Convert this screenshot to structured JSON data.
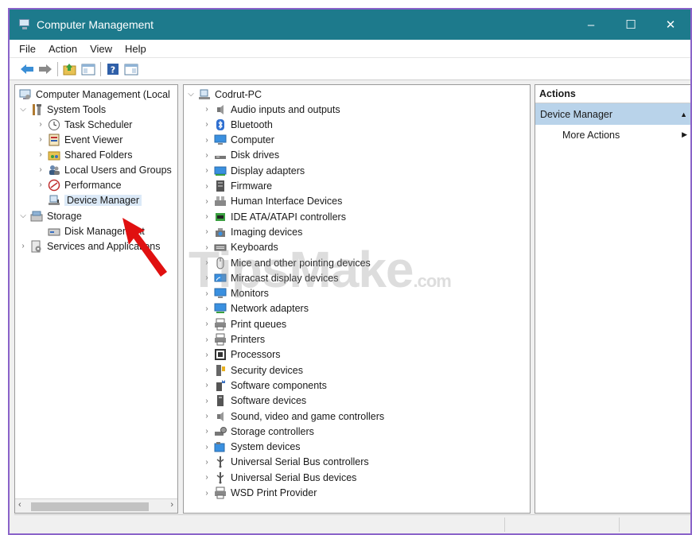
{
  "window": {
    "title": "Computer Management",
    "minimize": "–",
    "maximize": "☐",
    "close": "✕"
  },
  "menu": [
    "File",
    "Action",
    "View",
    "Help"
  ],
  "tree": {
    "root": "Computer Management (Local",
    "system_tools": "System Tools",
    "system_items": [
      "Task Scheduler",
      "Event Viewer",
      "Shared Folders",
      "Local Users and Groups",
      "Performance",
      "Device Manager"
    ],
    "storage": "Storage",
    "disk_management": "Disk Management",
    "services": "Services and Applications"
  },
  "devices": {
    "root": "Codrut-PC",
    "items": [
      {
        "label": "Audio inputs and outputs",
        "icon": "speaker-icon"
      },
      {
        "label": "Bluetooth",
        "icon": "bluetooth-icon"
      },
      {
        "label": "Computer",
        "icon": "computer-icon"
      },
      {
        "label": "Disk drives",
        "icon": "disk-drive-icon"
      },
      {
        "label": "Display adapters",
        "icon": "display-adapter-icon"
      },
      {
        "label": "Firmware",
        "icon": "firmware-icon"
      },
      {
        "label": "Human Interface Devices",
        "icon": "hid-icon"
      },
      {
        "label": "IDE ATA/ATAPI controllers",
        "icon": "ide-controller-icon"
      },
      {
        "label": "Imaging devices",
        "icon": "camera-icon"
      },
      {
        "label": "Keyboards",
        "icon": "keyboard-icon"
      },
      {
        "label": "Mice and other pointing devices",
        "icon": "mouse-icon"
      },
      {
        "label": "Miracast display devices",
        "icon": "miracast-icon"
      },
      {
        "label": "Monitors",
        "icon": "monitor-icon"
      },
      {
        "label": "Network adapters",
        "icon": "network-adapter-icon"
      },
      {
        "label": "Print queues",
        "icon": "printer-icon"
      },
      {
        "label": "Printers",
        "icon": "printer-icon"
      },
      {
        "label": "Processors",
        "icon": "processor-icon"
      },
      {
        "label": "Security devices",
        "icon": "security-device-icon"
      },
      {
        "label": "Software components",
        "icon": "software-component-icon"
      },
      {
        "label": "Software devices",
        "icon": "software-device-icon"
      },
      {
        "label": "Sound, video and game controllers",
        "icon": "speaker-icon"
      },
      {
        "label": "Storage controllers",
        "icon": "storage-controller-icon"
      },
      {
        "label": "System devices",
        "icon": "system-device-icon"
      },
      {
        "label": "Universal Serial Bus controllers",
        "icon": "usb-icon"
      },
      {
        "label": "Universal Serial Bus devices",
        "icon": "usb-icon"
      },
      {
        "label": "WSD Print Provider",
        "icon": "printer-icon"
      }
    ]
  },
  "actions": {
    "header": "Actions",
    "section": "Device Manager",
    "more": "More Actions"
  },
  "watermark": {
    "main": "TipsMake",
    "suffix": ".com"
  },
  "colors": {
    "titlebar": "#1d7a8c",
    "frame": "#8a63c9",
    "selection": "#dbe9f7",
    "actions_section": "#b9d3ea",
    "arrow": "#e01010"
  }
}
